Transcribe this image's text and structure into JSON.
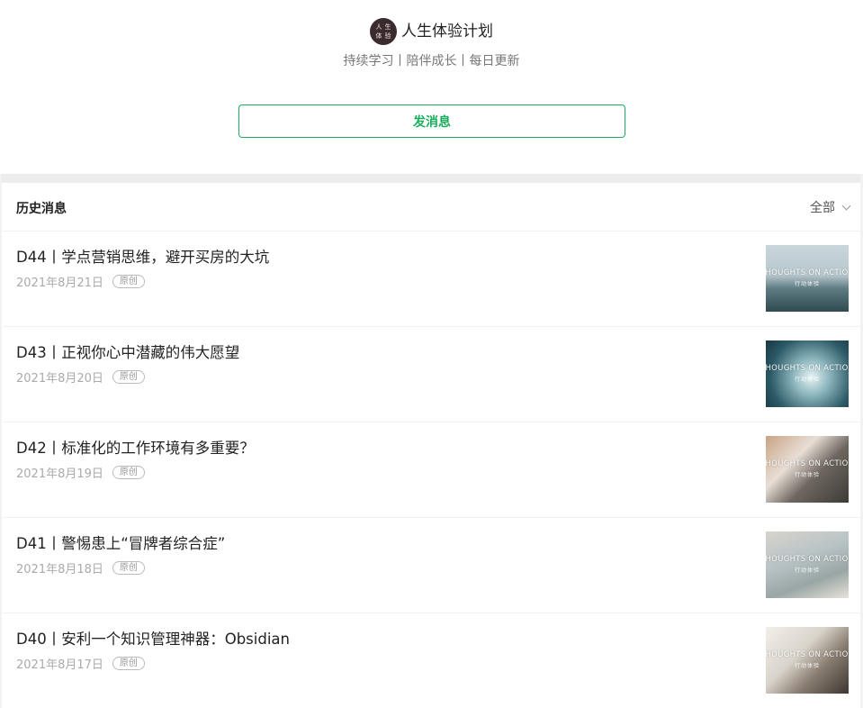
{
  "profile": {
    "avatar_chars": [
      "人",
      "生",
      "体",
      "验"
    ],
    "name": "人生体验计划",
    "bio": "持续学习丨陪伴成长丨每日更新",
    "send_button": "发消息"
  },
  "history": {
    "title": "历史消息",
    "filter_label": "全部"
  },
  "articles": [
    {
      "title": "D44丨学点营销思维，避开买房的大坑",
      "date": "2021年8月21日",
      "badge": "原创",
      "thumb_text": "THOUGHTS ON ACTION",
      "thumb_sub": "行动体验"
    },
    {
      "title": "D43丨正视你心中潜藏的伟大愿望",
      "date": "2021年8月20日",
      "badge": "原创",
      "thumb_text": "THOUGHTS ON ACTION",
      "thumb_sub": "行动体验"
    },
    {
      "title": "D42丨标准化的工作环境有多重要？",
      "date": "2021年8月19日",
      "badge": "原创",
      "thumb_text": "THOUGHTS ON ACTION",
      "thumb_sub": "行动体验"
    },
    {
      "title": "D41丨警惕患上“冒牌者综合症”",
      "date": "2021年8月18日",
      "badge": "原创",
      "thumb_text": "THOUGHTS ON ACTION",
      "thumb_sub": "行动体验"
    },
    {
      "title": "D40丨安利一个知识管理神器：Obsidian",
      "date": "2021年8月17日",
      "badge": "原创",
      "thumb_text": "THOUGHTS ON ACTION",
      "thumb_sub": "行动体验"
    }
  ],
  "colors": {
    "accent": "#1aad5c",
    "avatar_bg": "#3b2a2e",
    "divider": "#ededed"
  }
}
